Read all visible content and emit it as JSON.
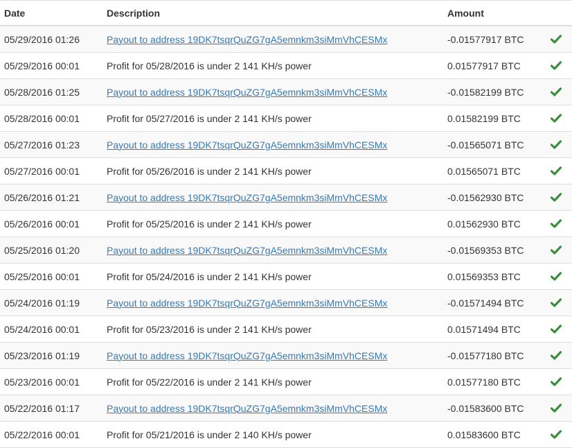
{
  "header": {
    "date": "Date",
    "description": "Description",
    "amount": "Amount"
  },
  "colors": {
    "link": "#337ab7",
    "check": "#3a8d3a",
    "stripe": "#f9f9f9",
    "border": "#dddddd"
  },
  "status_icon": "check-icon",
  "rows": [
    {
      "date": "05/29/2016 01:26",
      "description": "Payout to address 19DK7tsqrQuZG7gA5emnkm3siMmVhCESMx",
      "amount": "-0.01577917 BTC",
      "type": "payout"
    },
    {
      "date": "05/29/2016 00:01",
      "description": "Profit for 05/28/2016 is under 2 141 KH/s power",
      "amount": "0.01577917 BTC",
      "type": "profit"
    },
    {
      "date": "05/28/2016 01:25",
      "description": "Payout to address 19DK7tsqrQuZG7gA5emnkm3siMmVhCESMx",
      "amount": "-0.01582199 BTC",
      "type": "payout"
    },
    {
      "date": "05/28/2016 00:01",
      "description": "Profit for 05/27/2016 is under 2 141 KH/s power",
      "amount": "0.01582199 BTC",
      "type": "profit"
    },
    {
      "date": "05/27/2016 01:23",
      "description": "Payout to address 19DK7tsqrQuZG7gA5emnkm3siMmVhCESMx",
      "amount": "-0.01565071 BTC",
      "type": "payout"
    },
    {
      "date": "05/27/2016 00:01",
      "description": "Profit for 05/26/2016 is under 2 141 KH/s power",
      "amount": "0.01565071 BTC",
      "type": "profit"
    },
    {
      "date": "05/26/2016 01:21",
      "description": "Payout to address 19DK7tsqrQuZG7gA5emnkm3siMmVhCESMx",
      "amount": "-0.01562930 BTC",
      "type": "payout"
    },
    {
      "date": "05/26/2016 00:01",
      "description": "Profit for 05/25/2016 is under 2 141 KH/s power",
      "amount": "0.01562930 BTC",
      "type": "profit"
    },
    {
      "date": "05/25/2016 01:20",
      "description": "Payout to address 19DK7tsqrQuZG7gA5emnkm3siMmVhCESMx",
      "amount": "-0.01569353 BTC",
      "type": "payout"
    },
    {
      "date": "05/25/2016 00:01",
      "description": "Profit for 05/24/2016 is under 2 141 KH/s power",
      "amount": "0.01569353 BTC",
      "type": "profit"
    },
    {
      "date": "05/24/2016 01:19",
      "description": "Payout to address 19DK7tsqrQuZG7gA5emnkm3siMmVhCESMx",
      "amount": "-0.01571494 BTC",
      "type": "payout"
    },
    {
      "date": "05/24/2016 00:01",
      "description": "Profit for 05/23/2016 is under 2 141 KH/s power",
      "amount": "0.01571494 BTC",
      "type": "profit"
    },
    {
      "date": "05/23/2016 01:19",
      "description": "Payout to address 19DK7tsqrQuZG7gA5emnkm3siMmVhCESMx",
      "amount": "-0.01577180 BTC",
      "type": "payout"
    },
    {
      "date": "05/23/2016 00:01",
      "description": "Profit for 05/22/2016 is under 2 141 KH/s power",
      "amount": "0.01577180 BTC",
      "type": "profit"
    },
    {
      "date": "05/22/2016 01:17",
      "description": "Payout to address 19DK7tsqrQuZG7gA5emnkm3siMmVhCESMx",
      "amount": "-0.01583600 BTC",
      "type": "payout"
    },
    {
      "date": "05/22/2016 00:01",
      "description": "Profit for 05/21/2016 is under 2 140 KH/s power",
      "amount": "0.01583600 BTC",
      "type": "profit"
    }
  ]
}
